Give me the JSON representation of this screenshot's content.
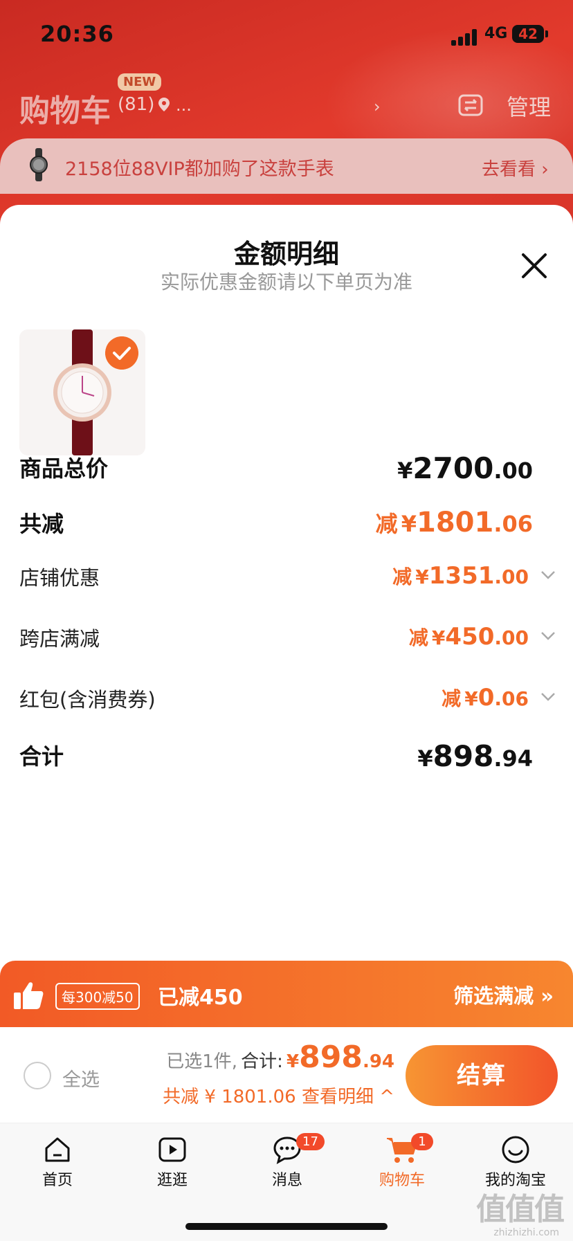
{
  "status_bar": {
    "time": "20:36",
    "network": "4G",
    "battery": "42"
  },
  "header": {
    "title": "购物车",
    "new_badge": "NEW",
    "count": "(81)",
    "location": "...",
    "chevron": "›",
    "manage": "管理"
  },
  "vip_banner": {
    "text": "2158位88VIP都加购了这款手表",
    "action": "去看看 ›"
  },
  "sheet": {
    "title": "金额明细",
    "subtitle": "实际优惠金额请以下单页为准",
    "rows": [
      {
        "label": "商品总价",
        "prefix": "",
        "yen": "¥",
        "int": "2700",
        "dec": ".00"
      },
      {
        "label": "共减",
        "prefix": "减",
        "yen": "¥",
        "int": "1801",
        "dec": ".06"
      },
      {
        "label": "店铺优惠",
        "prefix": "减",
        "yen": "¥",
        "int": "1351",
        "dec": ".00"
      },
      {
        "label": "跨店满减",
        "prefix": "减",
        "yen": "¥",
        "int": "450",
        "dec": ".00"
      },
      {
        "label": "红包(含消费券)",
        "prefix": "减",
        "yen": "¥",
        "int": "0",
        "dec": ".06"
      },
      {
        "label": "合计",
        "prefix": "",
        "yen": "¥",
        "int": "898",
        "dec": ".94"
      }
    ]
  },
  "promo_bar": {
    "tag": "每300减50",
    "done": "已减450",
    "filter": "筛选满减 »"
  },
  "checkout": {
    "select_all": "全选",
    "selected": "已选1件,",
    "total_label": "合计:",
    "yen": "¥",
    "total_int": "898",
    "total_dec": ".94",
    "saved": "共减 ¥ 1801.06 查看明细 ^",
    "pay": "结算"
  },
  "tabs": [
    {
      "label": "首页",
      "badge": ""
    },
    {
      "label": "逛逛",
      "badge": ""
    },
    {
      "label": "消息",
      "badge": "17"
    },
    {
      "label": "购物车",
      "badge": "1"
    },
    {
      "label": "我的淘宝",
      "badge": ""
    }
  ],
  "watermark": {
    "logo": "值值值",
    "url": "zhizhizhi.com"
  },
  "colors": {
    "accent": "#f26a28",
    "header_red": "#d8352a"
  }
}
